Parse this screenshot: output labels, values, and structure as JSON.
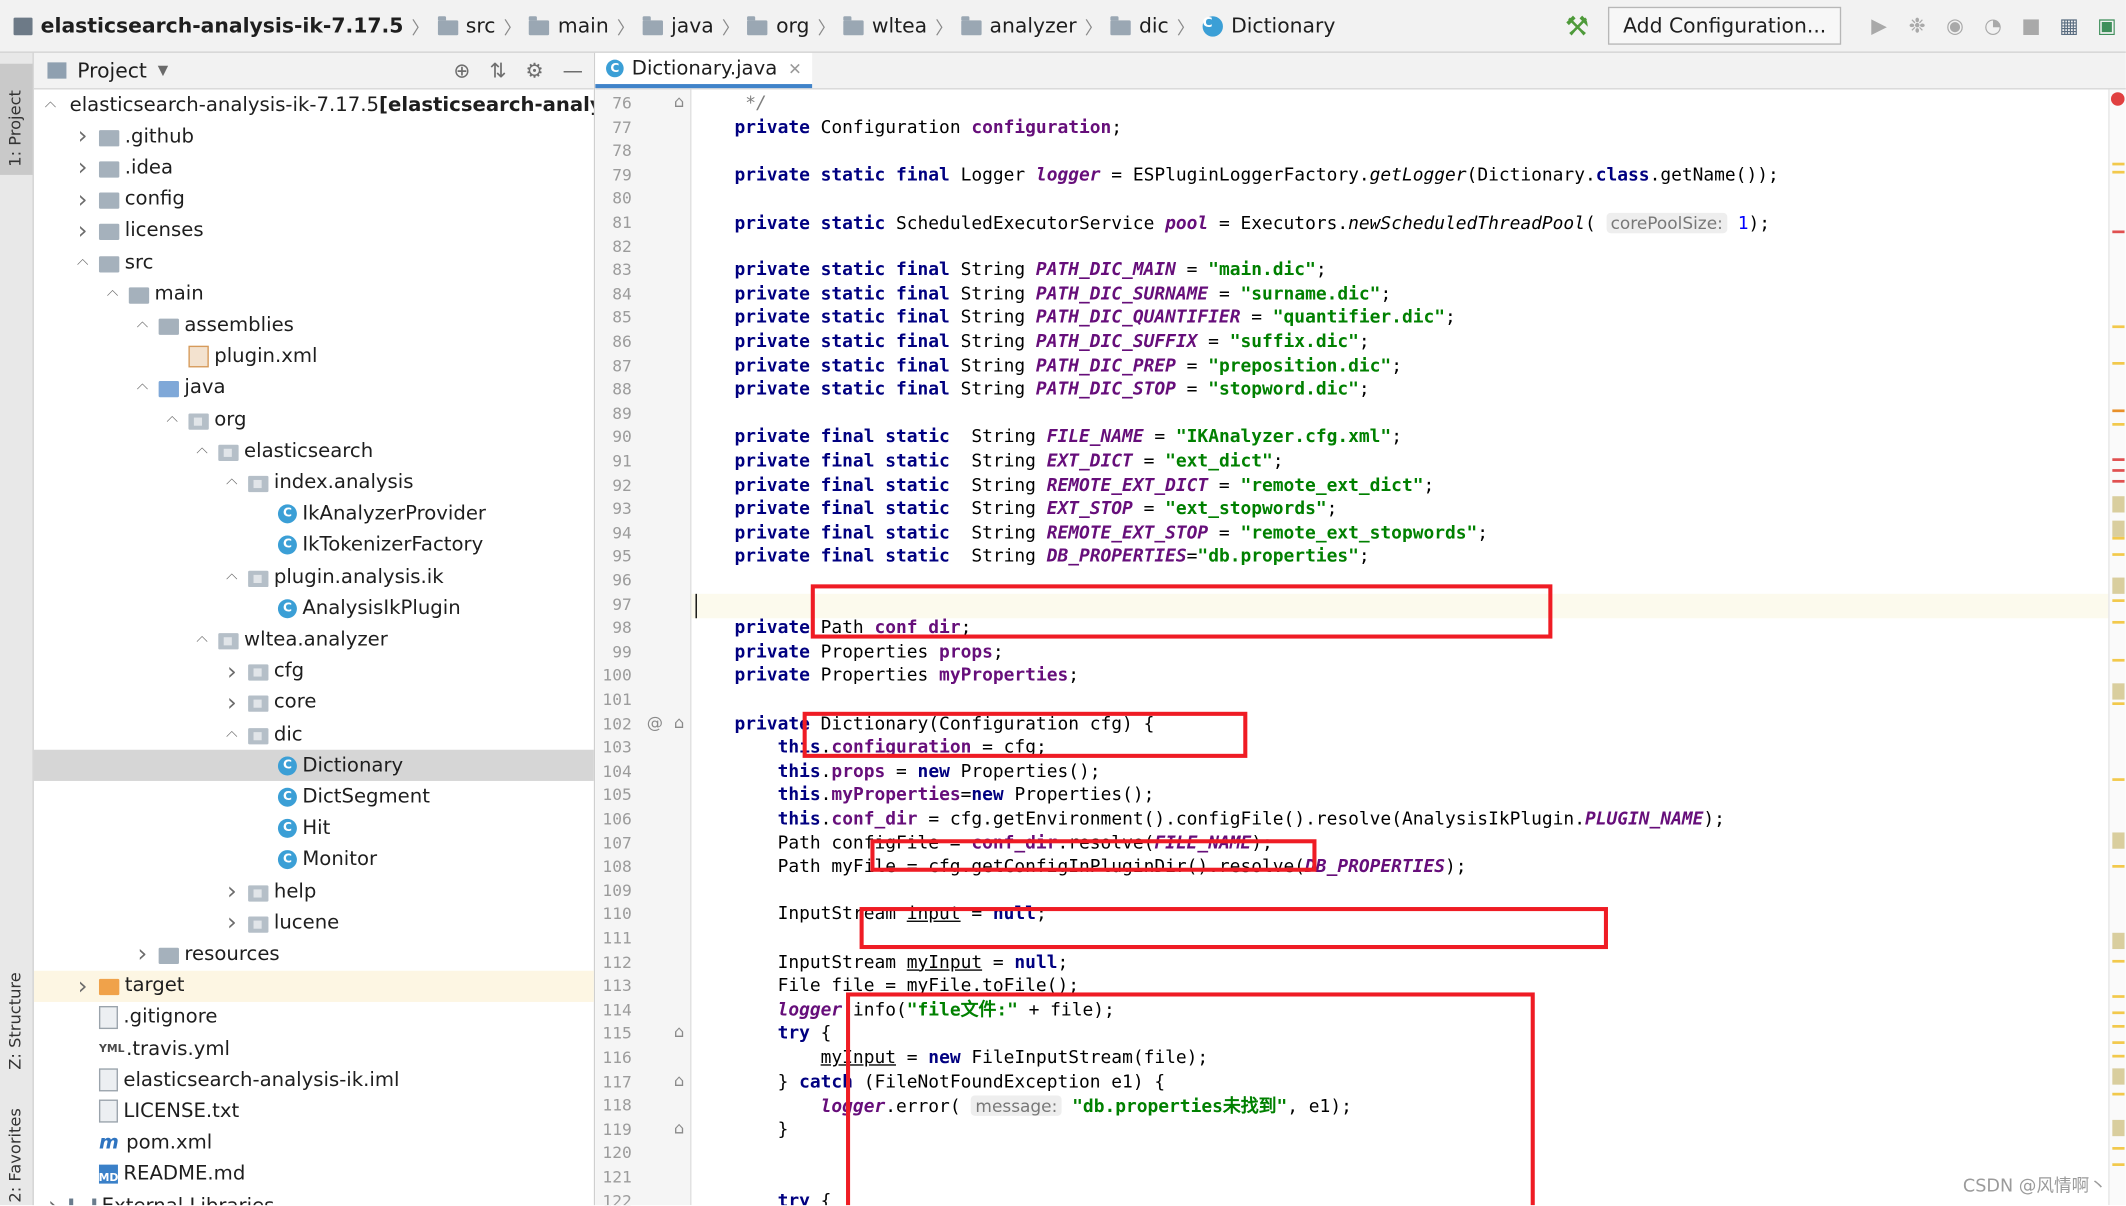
{
  "breadcrumbs": [
    {
      "label": "elasticsearch-analysis-ik-7.17.5",
      "icon": "project-icon"
    },
    {
      "label": "src",
      "icon": "folder-icon"
    },
    {
      "label": "main",
      "icon": "folder-icon"
    },
    {
      "label": "java",
      "icon": "folder-icon"
    },
    {
      "label": "org",
      "icon": "folder-icon"
    },
    {
      "label": "wltea",
      "icon": "folder-icon"
    },
    {
      "label": "analyzer",
      "icon": "folder-icon"
    },
    {
      "label": "dic",
      "icon": "folder-icon"
    },
    {
      "label": "Dictionary",
      "icon": "class-icon"
    }
  ],
  "toolbar": {
    "add_configuration_label": "Add Configuration...",
    "buttons": [
      "build-hammer-icon",
      "run-icon",
      "debug-icon",
      "coverage-icon",
      "profile-icon",
      "stop-icon",
      "project-structure-icon",
      "terminal-icon"
    ]
  },
  "side_tabs": {
    "project": "1: Project",
    "structure": "Z: Structure",
    "favorites": "2: Favorites"
  },
  "project_panel": {
    "title": "Project",
    "tree": [
      {
        "label": "elasticsearch-analysis-ik-7.17.5",
        "suffix": " [elasticsearch-analysis-ik]",
        "depth": 0,
        "arrow": "down",
        "icon": "project"
      },
      {
        "label": ".github",
        "depth": 1,
        "arrow": "right",
        "icon": "folder"
      },
      {
        "label": ".idea",
        "depth": 1,
        "arrow": "right",
        "icon": "folder"
      },
      {
        "label": "config",
        "depth": 1,
        "arrow": "right",
        "icon": "folder"
      },
      {
        "label": "licenses",
        "depth": 1,
        "arrow": "right",
        "icon": "folder"
      },
      {
        "label": "src",
        "depth": 1,
        "arrow": "down",
        "icon": "folder"
      },
      {
        "label": "main",
        "depth": 2,
        "arrow": "down",
        "icon": "folder"
      },
      {
        "label": "assemblies",
        "depth": 3,
        "arrow": "down",
        "icon": "folder"
      },
      {
        "label": "plugin.xml",
        "depth": 4,
        "arrow": "",
        "icon": "xml"
      },
      {
        "label": "java",
        "depth": 3,
        "arrow": "down",
        "icon": "src"
      },
      {
        "label": "org",
        "depth": 4,
        "arrow": "down",
        "icon": "pkg"
      },
      {
        "label": "elasticsearch",
        "depth": 5,
        "arrow": "down",
        "icon": "pkg"
      },
      {
        "label": "index.analysis",
        "depth": 6,
        "arrow": "down",
        "icon": "pkg"
      },
      {
        "label": "IkAnalyzerProvider",
        "depth": 7,
        "arrow": "",
        "icon": "class"
      },
      {
        "label": "IkTokenizerFactory",
        "depth": 7,
        "arrow": "",
        "icon": "class"
      },
      {
        "label": "plugin.analysis.ik",
        "depth": 6,
        "arrow": "down",
        "icon": "pkg"
      },
      {
        "label": "AnalysisIkPlugin",
        "depth": 7,
        "arrow": "",
        "icon": "class"
      },
      {
        "label": "wltea.analyzer",
        "depth": 5,
        "arrow": "down",
        "icon": "pkg"
      },
      {
        "label": "cfg",
        "depth": 6,
        "arrow": "right",
        "icon": "pkg"
      },
      {
        "label": "core",
        "depth": 6,
        "arrow": "right",
        "icon": "pkg"
      },
      {
        "label": "dic",
        "depth": 6,
        "arrow": "down",
        "icon": "pkg"
      },
      {
        "label": "Dictionary",
        "depth": 7,
        "arrow": "",
        "icon": "class",
        "selected": true
      },
      {
        "label": "DictSegment",
        "depth": 7,
        "arrow": "",
        "icon": "class"
      },
      {
        "label": "Hit",
        "depth": 7,
        "arrow": "",
        "icon": "class"
      },
      {
        "label": "Monitor",
        "depth": 7,
        "arrow": "",
        "icon": "class"
      },
      {
        "label": "help",
        "depth": 6,
        "arrow": "right",
        "icon": "pkg"
      },
      {
        "label": "lucene",
        "depth": 6,
        "arrow": "right",
        "icon": "pkg"
      },
      {
        "label": "resources",
        "depth": 3,
        "arrow": "right",
        "icon": "res"
      },
      {
        "label": "target",
        "depth": 1,
        "arrow": "right",
        "icon": "tgt",
        "highlight": true
      },
      {
        "label": ".gitignore",
        "depth": 1,
        "arrow": "",
        "icon": "file"
      },
      {
        "label": ".travis.yml",
        "depth": 1,
        "arrow": "",
        "icon": "yml"
      },
      {
        "label": "elasticsearch-analysis-ik.iml",
        "depth": 1,
        "arrow": "",
        "icon": "file"
      },
      {
        "label": "LICENSE.txt",
        "depth": 1,
        "arrow": "",
        "icon": "file"
      },
      {
        "label": "pom.xml",
        "depth": 1,
        "arrow": "",
        "icon": "m"
      },
      {
        "label": "README.md",
        "depth": 1,
        "arrow": "",
        "icon": "md"
      },
      {
        "label": "External Libraries",
        "depth": 0,
        "arrow": "right",
        "icon": "lib"
      }
    ]
  },
  "editor": {
    "tab_label": "Dictionary.java",
    "first_line": 76,
    "current_line": 97,
    "lines": [
      [
        [
          "cm",
          "     */"
        ]
      ],
      [
        [
          "kw",
          "    private "
        ],
        [
          "",
          "Configuration "
        ],
        [
          "fi",
          "configuration"
        ],
        [
          "",
          ";"
        ]
      ],
      [],
      [
        [
          "kw",
          "    private static final "
        ],
        [
          "",
          "Logger "
        ],
        [
          "fs",
          "logger"
        ],
        [
          "",
          " = ESPluginLoggerFactory."
        ],
        [
          "it",
          "getLogger"
        ],
        [
          "",
          "(Dictionary."
        ],
        [
          "kw",
          "class"
        ],
        [
          "",
          ".getName());"
        ]
      ],
      [],
      [
        [
          "kw",
          "    private static "
        ],
        [
          "",
          "ScheduledExecutorService "
        ],
        [
          "fs",
          "pool"
        ],
        [
          "",
          " = Executors."
        ],
        [
          "it",
          "newScheduledThreadPool"
        ],
        [
          "",
          "( "
        ],
        [
          "hint",
          "corePoolSize:"
        ],
        [
          "",
          " "
        ],
        [
          "nm",
          "1"
        ],
        [
          "",
          ");"
        ]
      ],
      [],
      [
        [
          "kw",
          "    private static final "
        ],
        [
          "",
          "String "
        ],
        [
          "fs",
          "PATH_DIC_MAIN"
        ],
        [
          "",
          " = "
        ],
        [
          "st",
          "\"main.dic\""
        ],
        [
          "",
          ";"
        ]
      ],
      [
        [
          "kw",
          "    private static final "
        ],
        [
          "",
          "String "
        ],
        [
          "fs",
          "PATH_DIC_SURNAME"
        ],
        [
          "",
          " = "
        ],
        [
          "st",
          "\"surname.dic\""
        ],
        [
          "",
          ";"
        ]
      ],
      [
        [
          "kw",
          "    private static final "
        ],
        [
          "",
          "String "
        ],
        [
          "fs",
          "PATH_DIC_QUANTIFIER"
        ],
        [
          "",
          " = "
        ],
        [
          "st",
          "\"quantifier.dic\""
        ],
        [
          "",
          ";"
        ]
      ],
      [
        [
          "kw",
          "    private static final "
        ],
        [
          "",
          "String "
        ],
        [
          "fs",
          "PATH_DIC_SUFFIX"
        ],
        [
          "",
          " = "
        ],
        [
          "st",
          "\"suffix.dic\""
        ],
        [
          "",
          ";"
        ]
      ],
      [
        [
          "kw",
          "    private static final "
        ],
        [
          "",
          "String "
        ],
        [
          "fs",
          "PATH_DIC_PREP"
        ],
        [
          "",
          " = "
        ],
        [
          "st",
          "\"preposition.dic\""
        ],
        [
          "",
          ";"
        ]
      ],
      [
        [
          "kw",
          "    private static final "
        ],
        [
          "",
          "String "
        ],
        [
          "fs",
          "PATH_DIC_STOP"
        ],
        [
          "",
          " = "
        ],
        [
          "st",
          "\"stopword.dic\""
        ],
        [
          "",
          ";"
        ]
      ],
      [],
      [
        [
          "kw",
          "    private final static  "
        ],
        [
          "",
          "String "
        ],
        [
          "fs",
          "FILE_NAME"
        ],
        [
          "",
          " = "
        ],
        [
          "st",
          "\"IKAnalyzer.cfg.xml\""
        ],
        [
          "",
          ";"
        ]
      ],
      [
        [
          "kw",
          "    private final static  "
        ],
        [
          "",
          "String "
        ],
        [
          "fs",
          "EXT_DICT"
        ],
        [
          "",
          " = "
        ],
        [
          "st",
          "\"ext_dict\""
        ],
        [
          "",
          ";"
        ]
      ],
      [
        [
          "kw",
          "    private final static  "
        ],
        [
          "",
          "String "
        ],
        [
          "fs",
          "REMOTE_EXT_DICT"
        ],
        [
          "",
          " = "
        ],
        [
          "st",
          "\"remote_ext_dict\""
        ],
        [
          "",
          ";"
        ]
      ],
      [
        [
          "kw",
          "    private final static  "
        ],
        [
          "",
          "String "
        ],
        [
          "fs",
          "EXT_STOP"
        ],
        [
          "",
          " = "
        ],
        [
          "st",
          "\"ext_stopwords\""
        ],
        [
          "",
          ";"
        ]
      ],
      [
        [
          "kw",
          "    private final static  "
        ],
        [
          "",
          "String "
        ],
        [
          "fs",
          "REMOTE_EXT_STOP"
        ],
        [
          "",
          " = "
        ],
        [
          "st",
          "\"remote_ext_stopwords\""
        ],
        [
          "",
          ";"
        ]
      ],
      [
        [
          "kw",
          "    private final static  "
        ],
        [
          "",
          "String "
        ],
        [
          "fs",
          "DB_PROPERTIES"
        ],
        [
          "",
          "="
        ],
        [
          "st",
          "\"db.properties\""
        ],
        [
          "",
          ";"
        ]
      ],
      [],
      [],
      [
        [
          "kw",
          "    private "
        ],
        [
          "",
          "Path "
        ],
        [
          "fi",
          "conf_dir"
        ],
        [
          "",
          ";"
        ]
      ],
      [
        [
          "kw",
          "    private "
        ],
        [
          "",
          "Properties "
        ],
        [
          "fi",
          "props"
        ],
        [
          "",
          ";"
        ]
      ],
      [
        [
          "kw",
          "    private "
        ],
        [
          "",
          "Properties "
        ],
        [
          "fi",
          "myProperties"
        ],
        [
          "",
          ";"
        ]
      ],
      [],
      [
        [
          "kw",
          "    private "
        ],
        [
          "",
          "Dictionary(Configuration cfg) {"
        ]
      ],
      [
        [
          "kw",
          "        this"
        ],
        [
          "",
          "."
        ],
        [
          "fi",
          "configuration"
        ],
        [
          "",
          " = cfg;"
        ]
      ],
      [
        [
          "kw",
          "        this"
        ],
        [
          "",
          "."
        ],
        [
          "fi",
          "props"
        ],
        [
          "",
          " = "
        ],
        [
          "kw",
          "new "
        ],
        [
          "",
          "Properties();"
        ]
      ],
      [
        [
          "kw",
          "        this"
        ],
        [
          "",
          "."
        ],
        [
          "fi",
          "myProperties"
        ],
        [
          "",
          "="
        ],
        [
          "kw",
          "new "
        ],
        [
          "",
          "Properties();"
        ]
      ],
      [
        [
          "kw",
          "        this"
        ],
        [
          "",
          "."
        ],
        [
          "fi",
          "conf_dir"
        ],
        [
          "",
          " = cfg.getEnvironment().configFile().resolve(AnalysisIkPlugin."
        ],
        [
          "fs",
          "PLUGIN_NAME"
        ],
        [
          "",
          ");"
        ]
      ],
      [
        [
          "",
          "        Path configFile = "
        ],
        [
          "fi",
          "conf_dir"
        ],
        [
          "",
          ".resolve("
        ],
        [
          "fs",
          "FILE_NAME"
        ],
        [
          "",
          ");"
        ]
      ],
      [
        [
          "",
          "        Path myFile = cfg.getConfigInPluginDir().resolve("
        ],
        [
          "fs",
          "DB_PROPERTIES"
        ],
        [
          "",
          ");"
        ]
      ],
      [],
      [
        [
          "",
          "        InputStream "
        ],
        [
          "iv",
          "input"
        ],
        [
          "",
          " = "
        ],
        [
          "kw",
          "null"
        ],
        [
          "",
          ";"
        ]
      ],
      [],
      [
        [
          "",
          "        InputStream "
        ],
        [
          "iv",
          "myInput"
        ],
        [
          "",
          " = "
        ],
        [
          "kw",
          "null"
        ],
        [
          "",
          ";"
        ]
      ],
      [
        [
          "",
          "        File file = myFile.toFile();"
        ]
      ],
      [
        [
          "fs",
          "        logger"
        ],
        [
          "",
          ".info("
        ],
        [
          "st",
          "\"file文件:\""
        ],
        [
          "",
          " + file);"
        ]
      ],
      [
        [
          "kw",
          "        try "
        ],
        [
          "",
          "{"
        ]
      ],
      [
        [
          "",
          "            "
        ],
        [
          "iv",
          "myInput"
        ],
        [
          "",
          " = "
        ],
        [
          "kw",
          "new "
        ],
        [
          "",
          "FileInputStream(file);"
        ]
      ],
      [
        [
          "",
          "        } "
        ],
        [
          "kw",
          "catch "
        ],
        [
          "",
          "(FileNotFoundException e1) {"
        ]
      ],
      [
        [
          "fs",
          "            logger"
        ],
        [
          "",
          ".error( "
        ],
        [
          "hint",
          "message:"
        ],
        [
          "",
          " "
        ],
        [
          "st",
          "\"db.properties未找到\""
        ],
        [
          "",
          ", e1);"
        ]
      ],
      [
        [
          "",
          "        }"
        ]
      ],
      [],
      [],
      [
        [
          "kw",
          "        try "
        ],
        [
          "",
          "{"
        ]
      ]
    ]
  },
  "watermark": "CSDN @风情啊丶"
}
